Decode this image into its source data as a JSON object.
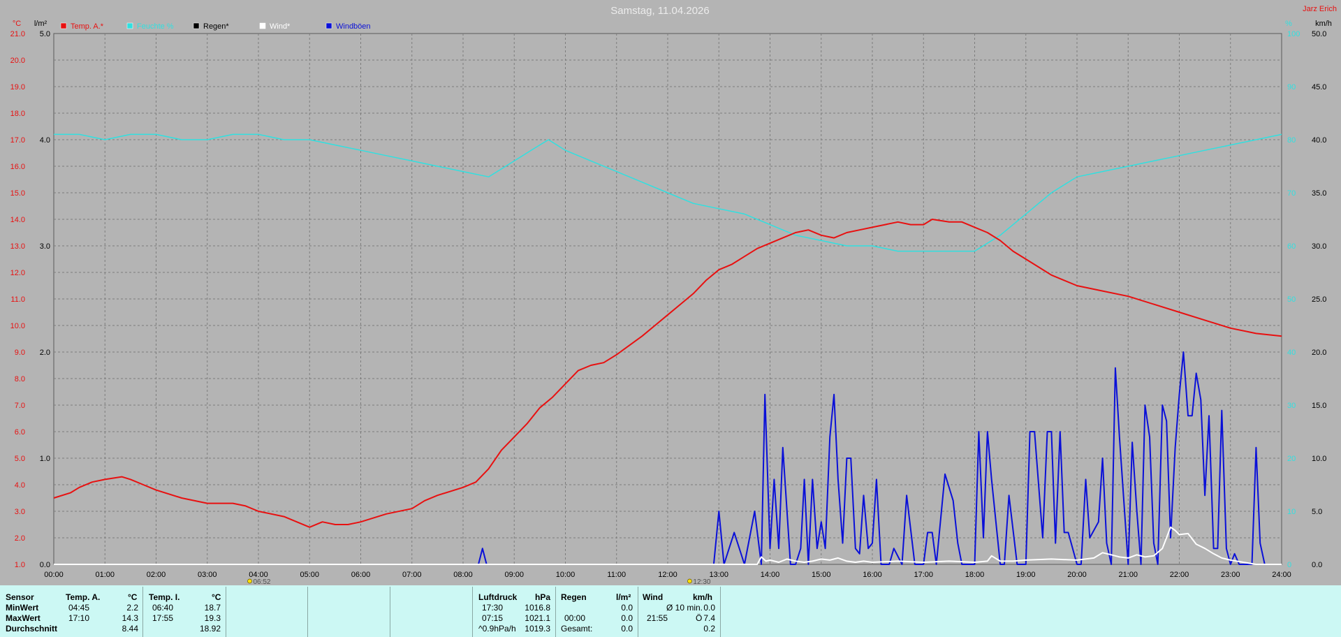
{
  "title": "Samstag, 11.04.2026",
  "station": "Jarz Erich",
  "colors": {
    "temp_a": "#e81010",
    "temp_i": "#30e0e0",
    "regen": "#000000",
    "wind": "#ffffff",
    "boeen": "#0a10d8",
    "bg": "#b4b4b4",
    "grid": "#7c7c7c"
  },
  "chart_data": {
    "type": "line",
    "x_unit": "time of day (h)",
    "xlim": [
      0,
      24
    ],
    "x_ticks": [
      "00:00",
      "01:00",
      "02:00",
      "03:00",
      "04:00",
      "05:00",
      "06:00",
      "07:00",
      "08:00",
      "09:00",
      "10:00",
      "11:00",
      "12:00",
      "13:00",
      "14:00",
      "15:00",
      "16:00",
      "17:00",
      "18:00",
      "19:00",
      "20:00",
      "21:00",
      "22:00",
      "23:00",
      "24:00"
    ],
    "axes": {
      "temp": {
        "unit": "°C",
        "lim": [
          1,
          21
        ],
        "ticks": [
          "21.0",
          "20.0",
          "19.0",
          "18.0",
          "17.0",
          "16.0",
          "15.0",
          "14.0",
          "13.0",
          "12.0",
          "11.0",
          "10.0",
          "9.0",
          "8.0",
          "7.0",
          "6.0",
          "5.0",
          "4.0",
          "3.0",
          "2.0",
          "1.0"
        ]
      },
      "rain": {
        "unit": "l/m²",
        "lim": [
          0,
          5
        ],
        "ticks": [
          "5.0",
          "4.0",
          "3.0",
          "2.0",
          "1.0",
          "0.0"
        ]
      },
      "humidity": {
        "unit": "%",
        "lim": [
          0,
          100
        ],
        "ticks": [
          "100",
          "90",
          "80",
          "70",
          "60",
          "50",
          "40",
          "30",
          "20",
          "10",
          "0"
        ]
      },
      "wind": {
        "unit": "km/h",
        "lim": [
          0,
          50
        ],
        "ticks": [
          "50.0",
          "45.0",
          "40.0",
          "35.0",
          "30.0",
          "25.0",
          "20.0",
          "15.0",
          "10.0",
          "5.0",
          "0.0"
        ]
      }
    },
    "legend": [
      "Temp. A.*",
      "Feuchte %",
      "Regen*",
      "Wind*",
      "Windböen"
    ],
    "series": [
      {
        "name": "Temp. A.*",
        "axis": "temp",
        "x": [
          0,
          0.33,
          0.5,
          0.75,
          1,
          1.33,
          1.5,
          1.75,
          2,
          2.5,
          3,
          3.5,
          3.75,
          4,
          4.5,
          4.75,
          5,
          5.25,
          5.5,
          5.75,
          6,
          6.5,
          7,
          7.25,
          7.5,
          8,
          8.25,
          8.5,
          8.75,
          9,
          9.25,
          9.5,
          9.75,
          10,
          10.25,
          10.5,
          10.75,
          11,
          11.5,
          11.75,
          12,
          12.25,
          12.5,
          12.75,
          13,
          13.25,
          13.5,
          13.75,
          14,
          14.25,
          14.5,
          14.75,
          15,
          15.25,
          15.5,
          15.75,
          16,
          16.25,
          16.5,
          16.75,
          17,
          17.17,
          17.5,
          17.75,
          18,
          18.25,
          18.5,
          18.75,
          19,
          19.25,
          19.5,
          19.75,
          20,
          20.5,
          21,
          21.5,
          22,
          22.5,
          23,
          23.5,
          24
        ],
        "values": [
          3.5,
          3.7,
          3.9,
          4.1,
          4.2,
          4.3,
          4.2,
          4.0,
          3.8,
          3.5,
          3.3,
          3.3,
          3.2,
          3.0,
          2.8,
          2.6,
          2.4,
          2.6,
          2.5,
          2.5,
          2.6,
          2.9,
          3.1,
          3.4,
          3.6,
          3.9,
          4.1,
          4.6,
          5.3,
          5.8,
          6.3,
          6.9,
          7.3,
          7.8,
          8.3,
          8.5,
          8.6,
          8.9,
          9.6,
          10.0,
          10.4,
          10.8,
          11.2,
          11.7,
          12.1,
          12.3,
          12.6,
          12.9,
          13.1,
          13.3,
          13.5,
          13.6,
          13.4,
          13.3,
          13.5,
          13.6,
          13.7,
          13.8,
          13.9,
          13.8,
          13.8,
          14.0,
          13.9,
          13.9,
          13.7,
          13.5,
          13.2,
          12.8,
          12.5,
          12.2,
          11.9,
          11.7,
          11.5,
          11.3,
          11.1,
          10.8,
          10.5,
          10.2,
          9.9,
          9.7,
          9.6
        ]
      },
      {
        "name": "Feuchte %",
        "axis": "humidity",
        "x": [
          0,
          0.5,
          1,
          1.5,
          2,
          2.5,
          3,
          3.5,
          4,
          4.5,
          5,
          5.5,
          6,
          6.5,
          7,
          7.5,
          8,
          8.5,
          9,
          9.33,
          9.67,
          10,
          10.5,
          11,
          11.5,
          12,
          12.5,
          13,
          13.5,
          14,
          14.5,
          15,
          15.5,
          16,
          16.5,
          17,
          17.5,
          18,
          18.5,
          19,
          19.5,
          20,
          20.5,
          21,
          21.5,
          22,
          22.5,
          23,
          23.5,
          24
        ],
        "values": [
          81,
          81,
          80,
          81,
          81,
          80,
          80,
          81,
          81,
          80,
          80,
          79,
          78,
          77,
          76,
          75,
          74,
          73,
          76,
          78,
          80,
          78,
          76,
          74,
          72,
          70,
          68,
          67,
          66,
          64,
          62,
          61,
          60,
          60,
          59,
          59,
          59,
          59,
          62,
          66,
          70,
          73,
          74,
          75,
          76,
          77,
          78,
          79,
          80,
          81
        ]
      },
      {
        "name": "Wind*",
        "axis": "wind",
        "x": [
          0,
          13.75,
          13.83,
          13.92,
          14,
          14.17,
          14.33,
          14.5,
          14.67,
          14.83,
          15,
          15.17,
          15.33,
          15.5,
          15.67,
          15.83,
          16,
          16.5,
          17,
          17.5,
          18,
          18.25,
          18.33,
          18.5,
          18.75,
          19,
          19.5,
          20,
          20.33,
          20.5,
          20.67,
          20.83,
          21,
          21.17,
          21.33,
          21.5,
          21.67,
          21.83,
          21.92,
          22,
          22.17,
          22.33,
          22.5,
          22.67,
          22.83,
          23,
          23.25,
          23.5,
          24
        ],
        "values": [
          0,
          0,
          0.7,
          0.3,
          0.4,
          0.2,
          0.5,
          0.3,
          0.2,
          0.3,
          0.5,
          0.4,
          0.6,
          0.3,
          0.2,
          0.3,
          0.2,
          0.3,
          0.2,
          0.3,
          0.2,
          0.3,
          0.8,
          0.3,
          0.3,
          0.4,
          0.5,
          0.4,
          0.6,
          1.1,
          0.9,
          0.7,
          0.6,
          0.9,
          0.7,
          0.8,
          1.5,
          3.5,
          3.2,
          2.8,
          2.9,
          1.9,
          1.5,
          1.0,
          0.6,
          0.4,
          0.2,
          0,
          0
        ]
      },
      {
        "name": "Windböen",
        "axis": "wind",
        "x": [
          0,
          8.3,
          8.38,
          8.46,
          12.7,
          12.9,
          13.0,
          13.1,
          13.3,
          13.5,
          13.6,
          13.7,
          13.83,
          13.9,
          14.0,
          14.08,
          14.17,
          14.25,
          14.4,
          14.5,
          14.6,
          14.67,
          14.75,
          14.83,
          14.92,
          15.0,
          15.08,
          15.17,
          15.25,
          15.33,
          15.42,
          15.5,
          15.58,
          15.67,
          15.75,
          15.83,
          15.92,
          16.0,
          16.08,
          16.17,
          16.33,
          16.42,
          16.58,
          16.67,
          16.83,
          17.0,
          17.08,
          17.17,
          17.25,
          17.42,
          17.58,
          17.67,
          17.75,
          18.0,
          18.08,
          18.17,
          18.25,
          18.33,
          18.5,
          18.58,
          18.67,
          18.83,
          19.0,
          19.08,
          19.17,
          19.33,
          19.42,
          19.5,
          19.58,
          19.67,
          19.75,
          19.83,
          20.0,
          20.08,
          20.17,
          20.25,
          20.42,
          20.5,
          20.58,
          20.67,
          20.75,
          20.83,
          21.0,
          21.08,
          21.17,
          21.25,
          21.33,
          21.42,
          21.5,
          21.58,
          21.67,
          21.75,
          21.83,
          21.92,
          22.0,
          22.08,
          22.17,
          22.25,
          22.33,
          22.42,
          22.5,
          22.58,
          22.67,
          22.75,
          22.83,
          22.92,
          23.0,
          23.08,
          23.17,
          23.33,
          23.42,
          23.5,
          23.58,
          23.67,
          23.75,
          24.0
        ],
        "values": [
          0,
          0,
          1.5,
          0,
          0,
          0,
          5,
          0,
          3,
          0,
          2.5,
          5,
          0,
          16,
          1.5,
          8,
          1.5,
          11,
          0,
          0,
          1.5,
          8,
          0,
          8,
          1.5,
          4,
          1.5,
          12,
          16,
          8,
          2,
          10,
          10,
          1.5,
          1,
          6.5,
          1.5,
          2,
          8,
          0,
          0,
          1.5,
          0,
          6.5,
          0,
          0,
          3,
          3,
          0,
          8.5,
          6,
          2,
          0,
          0,
          12.5,
          2.5,
          12.5,
          8,
          0,
          0,
          6.5,
          0,
          0,
          12.5,
          12.5,
          2.5,
          12.5,
          12.5,
          2,
          12.5,
          3,
          3,
          0,
          0,
          8,
          2.5,
          4,
          10,
          2,
          0,
          18.5,
          12,
          0,
          11.5,
          5,
          0,
          15,
          12,
          2,
          0,
          15,
          13.5,
          2.5,
          11,
          16,
          20,
          14,
          14,
          18,
          15.5,
          6.5,
          14,
          1.5,
          1.5,
          14.5,
          1.5,
          0,
          1,
          0,
          0,
          0,
          11,
          2,
          0,
          0,
          0
        ]
      }
    ]
  },
  "time_markers": [
    {
      "x": 3.87,
      "label": "06:52"
    },
    {
      "x": 12.47,
      "label": "12:30"
    }
  ],
  "stats": {
    "sensor": {
      "header": "Sensor",
      "rows": [
        "MinWert",
        "MaxWert",
        "Durchschnitt"
      ]
    },
    "temp_a": {
      "header": "Temp. A.",
      "unit": "°C",
      "min_time": "04:45",
      "min": "2.2",
      "max_time": "17:10",
      "max": "14.3",
      "avg": "8.44"
    },
    "temp_i": {
      "header": "Temp. I.",
      "unit": "°C",
      "min_time": "06:40",
      "min": "18.7",
      "max_time": "17:55",
      "max": "19.3",
      "avg": "18.92"
    },
    "pressure": {
      "header": "Luftdruck",
      "unit": "hPa",
      "min_time": "17:30",
      "min": "1016.8",
      "max_time": "07:15",
      "max": "1021.1",
      "trend": "^0.9hPa/h",
      "avg": "1019.3"
    },
    "rain": {
      "header": "Regen",
      "unit": "l/m²",
      "max_time": "00:00",
      "max": "0.0",
      "total_label": "Gesamt:",
      "total": "0.0",
      "min": "0.0"
    },
    "wind": {
      "header": "Wind",
      "unit": "km/h",
      "avg10_label": "Ø 10 min.",
      "avg10": "0.0",
      "max_time": "21:55",
      "max": "7.4",
      "max_sym": "Ö",
      "avg": "0.2"
    }
  }
}
